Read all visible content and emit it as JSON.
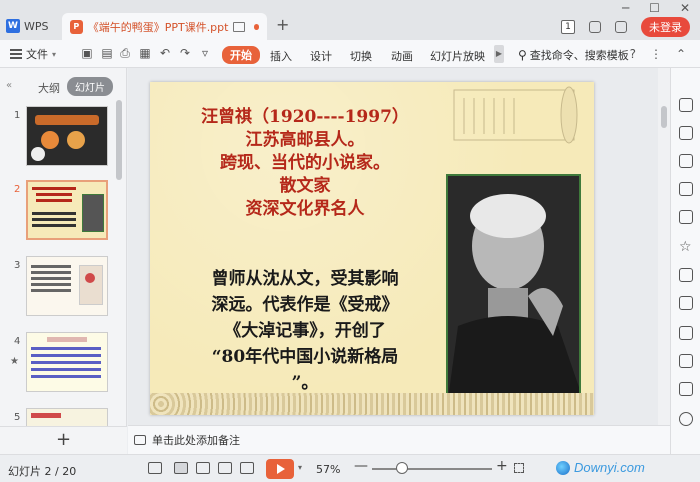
{
  "titlebar": {
    "app_label": "WPS",
    "doc_tab_title": "《端午的鸭蛋》PPT课件.ppt",
    "new_tab": "+",
    "badge": "1",
    "login": "未登录"
  },
  "ribbon": {
    "file": "文件",
    "tabs": [
      "开始",
      "插入",
      "设计",
      "切换",
      "动画",
      "幻灯片放映"
    ],
    "search": "查找命令、搜索模板",
    "help": "?",
    "more": "⋮"
  },
  "leftpanel": {
    "outline_tab": "大纲",
    "slides_tab": "幻灯片",
    "thumbs": [
      {
        "num": "1"
      },
      {
        "num": "2"
      },
      {
        "num": "3"
      },
      {
        "num": "4"
      },
      {
        "num": "5"
      }
    ],
    "add": "+"
  },
  "slide": {
    "red_lines": [
      "汪曾祺（1920----1997）",
      "江苏高邮县人。",
      "跨现、当代的小说家。",
      "散文家",
      "资深文化界名人"
    ],
    "black_lines": [
      "曾师从沈从文，受其影响",
      "深远。代表作是《受戒》",
      "《大淖记事》，开创了",
      "“80年代中国小说新格局",
      "”。"
    ]
  },
  "notes": {
    "placeholder": "单击此处添加备注"
  },
  "statusbar": {
    "slide_indicator": "幻灯片 2 / 20",
    "zoom": "57%",
    "zoom_minus": "—",
    "zoom_plus": "+"
  },
  "watermark": {
    "text": "Downyi.com"
  },
  "colors": {
    "accent": "#e8623a",
    "slide_bg": "#f6eab9",
    "slide_red": "#b5281a",
    "photo_border": "#3f7a3b"
  }
}
